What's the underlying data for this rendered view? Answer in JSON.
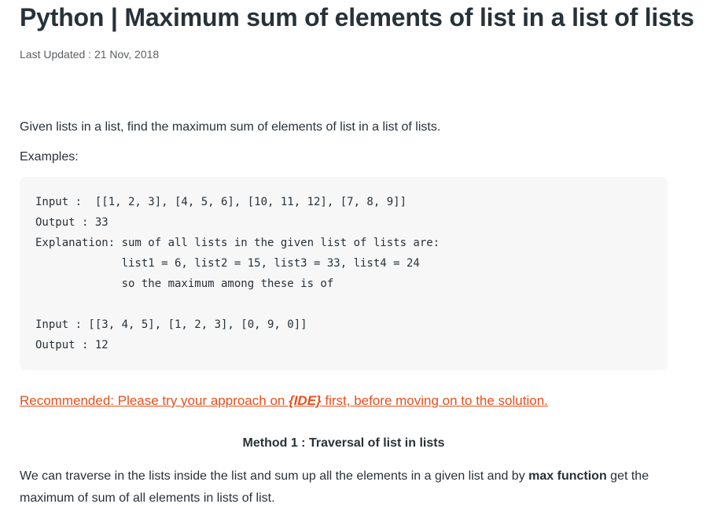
{
  "article": {
    "title": "Python | Maximum sum of elements of list in a list of lists",
    "last_updated": "Last Updated : 21 Nov, 2018",
    "intro": "Given lists in a list, find the maximum sum of elements of list in a list of lists.",
    "examples_label": "Examples:",
    "code_example": "Input :  [[1, 2, 3], [4, 5, 6], [10, 11, 12], [7, 8, 9]]\nOutput : 33\nExplanation: sum of all lists in the given list of lists are:\n             list1 = 6, list2 = 15, list3 = 33, list4 = 24\n             so the maximum among these is of\n\nInput : [[3, 4, 5], [1, 2, 3], [0, 9, 0]]\nOutput : 12",
    "recommended": {
      "prefix": "Recommended: Please try your approach on ",
      "ide": "{IDE}",
      "suffix": " first, before moving on to the solution."
    },
    "method_heading": "Method 1 : Traversal of list in lists",
    "paragraph": {
      "before_bold": "We can traverse in the lists inside the list and sum up all the elements in a given list and by ",
      "bold": "max function",
      "after_bold": " get the maximum of sum of all elements in lists of list."
    }
  },
  "colors": {
    "text": "#273239",
    "meta": "#5b5f62",
    "link": "#e8501e",
    "code_bg": "#f7f7f7"
  }
}
